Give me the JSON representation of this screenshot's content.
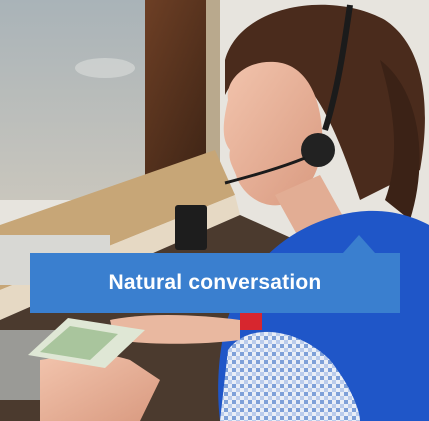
{
  "photo": {
    "scene": "photo",
    "callout_text": "Natural conversation",
    "colors": {
      "callout_bg": "#3a7fcf",
      "callout_text": "#ffffff",
      "vest": "#1f56c8"
    }
  }
}
